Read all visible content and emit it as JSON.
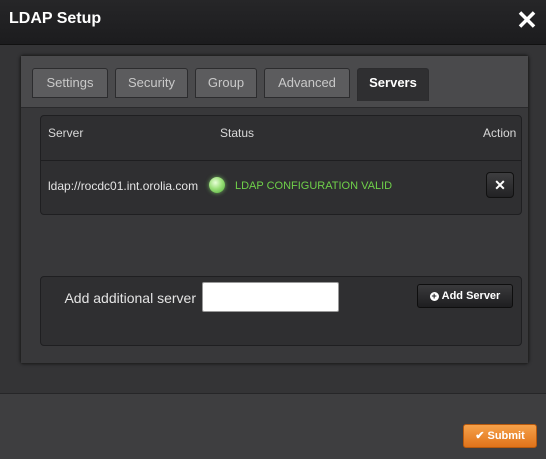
{
  "dialog": {
    "title": "LDAP Setup",
    "close_symbol": "✕"
  },
  "tabs": [
    {
      "label": "Settings",
      "active": false
    },
    {
      "label": "Security",
      "active": false
    },
    {
      "label": "Group",
      "active": false
    },
    {
      "label": "Advanced",
      "active": false
    },
    {
      "label": "Servers",
      "active": true
    }
  ],
  "servers_table": {
    "headers": {
      "server": "Server",
      "status": "Status",
      "action": "Action"
    },
    "rows": [
      {
        "server": "ldap://rocdc01.int.orolia.com",
        "status": "LDAP CONFIGURATION VALID",
        "status_color": "#6fd04a",
        "action_symbol": "✕"
      }
    ]
  },
  "add_server": {
    "label": "Add additional server",
    "input_value": "",
    "button_label": "Add Server",
    "button_icon": "plus-circle-icon"
  },
  "footer": {
    "submit_label": "Submit",
    "submit_icon": "checkmark-icon",
    "submit_color": "#f08a2c"
  }
}
